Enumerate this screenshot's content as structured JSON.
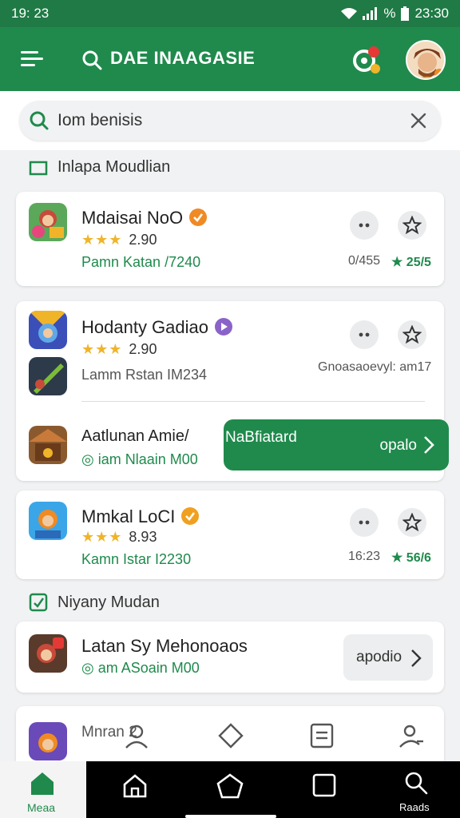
{
  "status_bar": {
    "time": "19: 23",
    "battery_text": "%",
    "clock": "23:30"
  },
  "app_bar": {
    "title": "DAE INAAGASIE"
  },
  "search": {
    "value": "Iom benisis",
    "placeholder": ""
  },
  "sections": [
    {
      "title": "Inlapa Moudlian"
    },
    {
      "title": "Niyany Mudan"
    }
  ],
  "cards": [
    {
      "name": "Mdaisai NoO",
      "stars": "★★★",
      "rating": "2.90",
      "subtitle": "Pamn Katan /7240",
      "meta_left": "0/455",
      "meta_right": "★ 25/5"
    },
    {
      "name": "Hodanty Gadiao",
      "stars": "★★★",
      "rating": "2.90",
      "subtitle": "Lamm Rstan IM234",
      "meta_right": "Gnoasaoevyl: am17"
    },
    {
      "name": "Aatlunan Amie/",
      "subtitle": "◎ iam Nlaain M00",
      "button_left": "NaBfiatard",
      "button_right": "opalo"
    },
    {
      "name": "Mmkal LoCI",
      "stars": "★★★",
      "rating": "8.93",
      "subtitle": "Kamn Istar I2230",
      "meta_left": "16:23",
      "meta_right": "★ 56/6"
    },
    {
      "name": "Latan Sy Mehonoaos",
      "subtitle": "◎ am ASoain M00",
      "button": "apodio"
    }
  ],
  "partial_card": {
    "name": "Mnran 2"
  },
  "bottom_nav": {
    "home_label": "Meaa",
    "search_label": "Raads"
  },
  "colors": {
    "primary": "#1f8a4c",
    "star": "#f0b429",
    "orange_badge": "#f08a24",
    "purple_badge": "#8a63c9"
  }
}
